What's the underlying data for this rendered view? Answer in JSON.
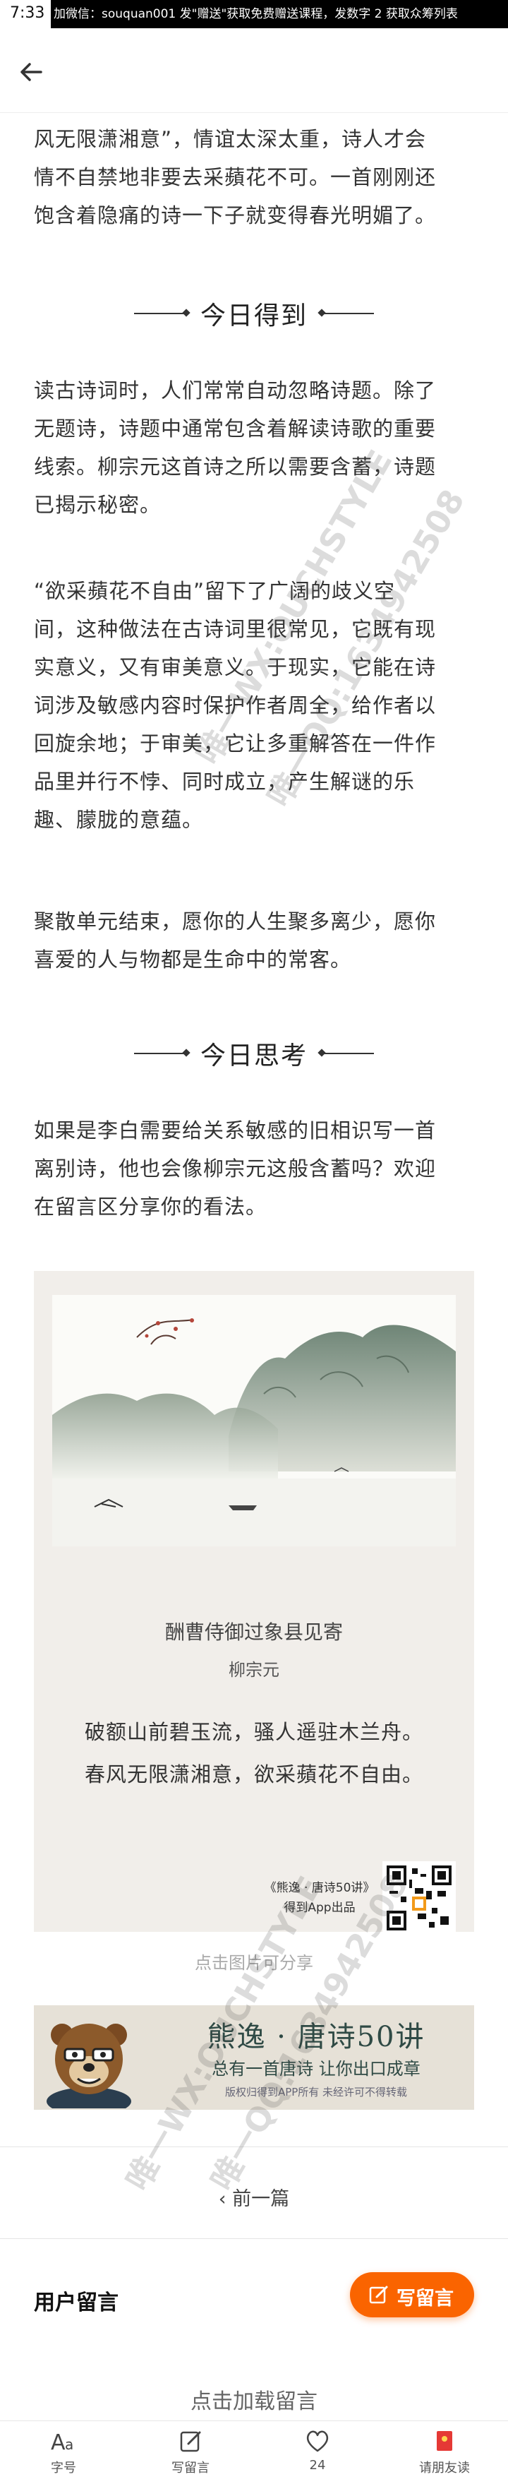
{
  "status_bar": {
    "time": "7:33",
    "banner_text": "加微信：souquan001   发\"赠送\"获取免费赠送课程，发数字 2 获取众筹列表"
  },
  "article": {
    "intro_lines": [
      "风无限潇湘意”，情谊太深太重，诗人才会",
      "情不自禁地非要去采蘋花不可。一首刚刚还",
      "饱含着隐痛的诗一下子就变得春光明媚了。"
    ],
    "section1_heading": "今日得到",
    "section1_paragraphs": [
      [
        "读古诗词时，人们常常自动忽略诗题。除了",
        "无题诗，诗题中通常包含着解读诗歌的重要",
        "线索。柳宗元这首诗之所以需要含蓄，诗题",
        "已揭示秘密。"
      ],
      [
        "“欲采蘋花不自由”留下了广阔的歧义空",
        "间，这种做法在古诗词里很常见，它既有现",
        "实意义，又有审美意义。于现实，它能在诗",
        "词涉及敏感内容时保护作者周全，给作者以",
        "回旋余地；于审美，它让多重解答在一件作",
        "品里并行不悖、同时成立，产生解谜的乐",
        "趣、朦胧的意蕴。"
      ],
      [
        "聚散单元结束，愿你的人生聚多离少，愿你",
        "喜爱的人与物都是生命中的常客。"
      ]
    ],
    "section2_heading": "今日思考",
    "section2_paragraph": [
      "如果是李白需要给关系敏感的旧相识写一首",
      "离别诗，他也会像柳宗元这般含蓄吗？欢迎",
      "在留言区分享你的看法。"
    ]
  },
  "poem_card": {
    "title": "酬曹侍御过象县见寄",
    "author": "柳宗元",
    "lines": [
      "破额山前碧玉流，骚人遥驻木兰舟。",
      "春风无限潇湘意，欲采蘋花不自由。"
    ],
    "source_line1": "《熊逸 · 唐诗50讲》",
    "source_line2": "得到App出品",
    "caption": "点击图片可分享"
  },
  "promo": {
    "title": "熊逸 · 唐诗50讲",
    "subtitle": "总有一首唐诗 让你出口成章",
    "note": "版权归得到APP所有 未经许可不得转载"
  },
  "navigation": {
    "prev_label": "‹ 前一篇"
  },
  "comments": {
    "title": "用户留言",
    "write_label": "写留言",
    "load_label": "点击加载留言"
  },
  "bottom_bar": {
    "tabs": [
      {
        "icon": "font-size-icon",
        "label": "字号"
      },
      {
        "icon": "edit-icon",
        "label": "写留言"
      },
      {
        "icon": "heart-icon",
        "label": "24"
      },
      {
        "icon": "invite-icon",
        "label": "请朋友读"
      }
    ]
  },
  "watermarks": {
    "upper": "唯一WX:OUCHSTYLE",
    "upper2": "唯一QQ:1634942508",
    "lower": "唯一WX:OUCHSTYLE",
    "lower2": "唯一QQ:1634942508"
  },
  "colors": {
    "accent": "#fa6400",
    "card_bg": "#f1eeea",
    "promo_bg": "#e6e1d7",
    "promo_text": "#2f4a45"
  }
}
